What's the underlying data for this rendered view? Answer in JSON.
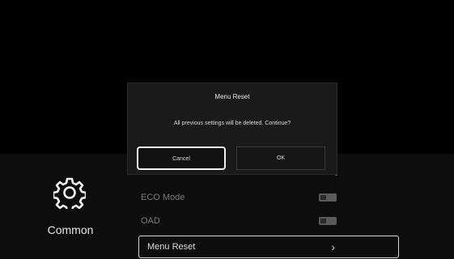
{
  "settings": {
    "category": {
      "label": "Common",
      "icon": "gear-icon"
    },
    "menu": [
      {
        "label": "ECO Mode",
        "control": "toggle"
      },
      {
        "label": "OAD",
        "control": "toggle"
      },
      {
        "label": "Menu Reset",
        "control": "chevron-right-icon",
        "selected": true
      }
    ]
  },
  "dialog": {
    "title": "Menu Reset",
    "message": "All previous settings will be deleted. Continue?",
    "cancel_label": "Cancel",
    "ok_label": "OK"
  },
  "colors": {
    "background": "#000000",
    "dialog": "#1a1a1a",
    "focus_border": "#f2f2f2"
  }
}
